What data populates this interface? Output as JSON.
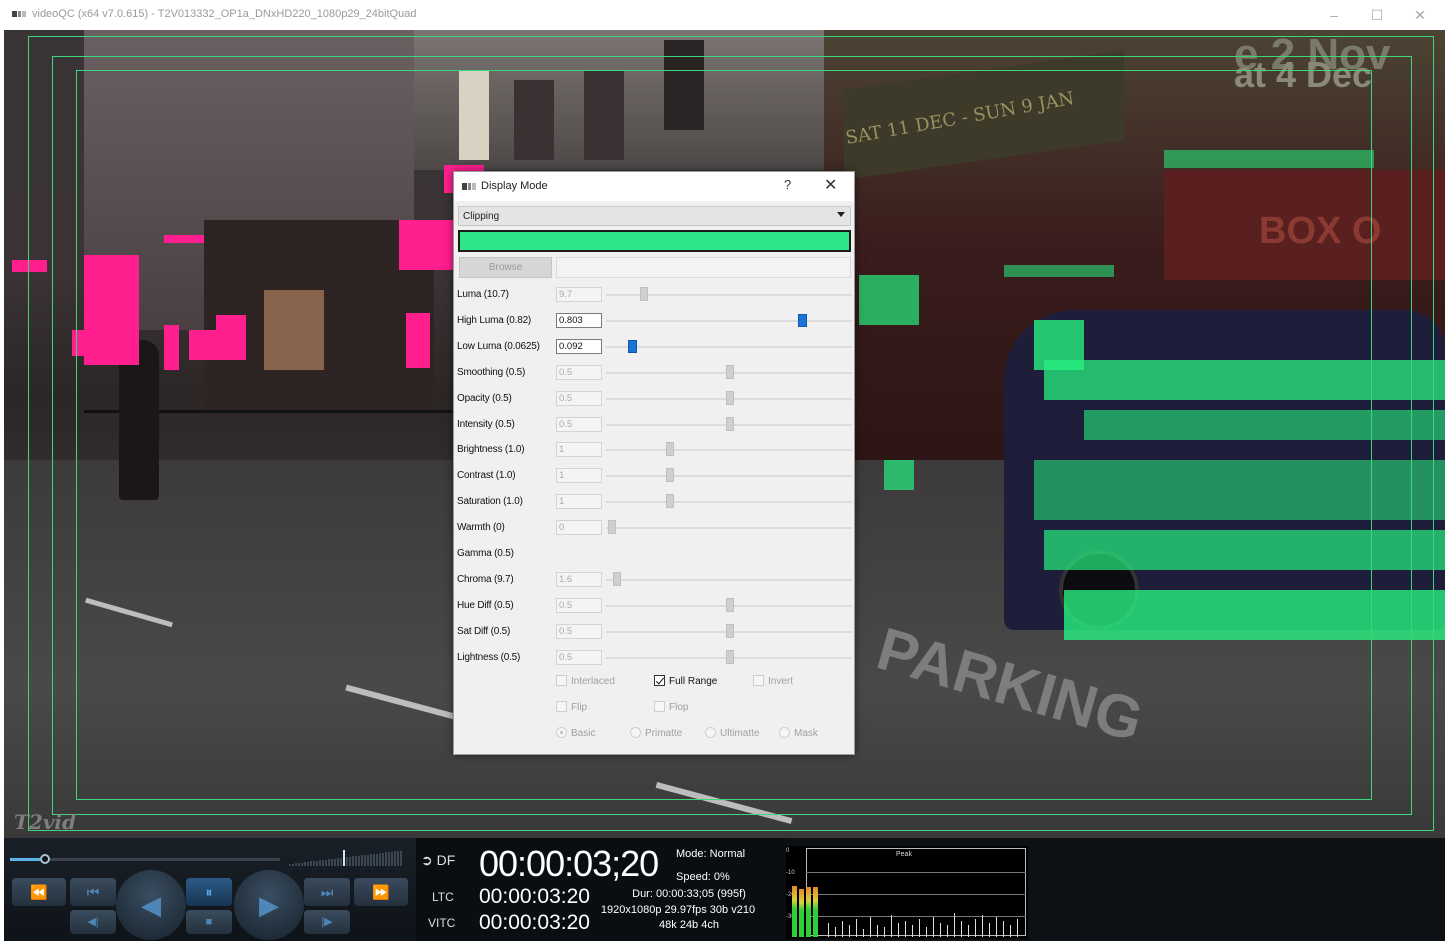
{
  "window": {
    "title": "videoQC (x64 v7.0.615) - T2V013332_OP1a_DNxHD220_1080p29_24bitQuad",
    "controls": {
      "minimize": "–",
      "maximize": "☐",
      "close": "✕"
    }
  },
  "video": {
    "signs": {
      "upper": "e 2 Nov",
      "lower": "at 4 Dec",
      "dates": "SAT 11 DEC - SUN 9 JAN",
      "box": "BOX O"
    },
    "road_text": "PARKING",
    "logo": "T2vid"
  },
  "dialog": {
    "title": "Display Mode",
    "help": "?",
    "close": "✕",
    "mode_selected": "Clipping",
    "clip_color": "#2ee68a",
    "browse_label": "Browse",
    "rows": [
      {
        "label": "Luma (10.7)",
        "value": "9.7",
        "active": false,
        "pos": 0.14
      },
      {
        "label": "High Luma (0.82)",
        "value": "0.803",
        "active": true,
        "pos": 0.8
      },
      {
        "label": "Low Luma (0.0625)",
        "value": "0.092",
        "active": true,
        "pos": 0.09
      },
      {
        "label": "Smoothing (0.5)",
        "value": "0.5",
        "active": false,
        "pos": 0.5
      },
      {
        "label": "Opacity (0.5)",
        "value": "0.5",
        "active": false,
        "pos": 0.5
      },
      {
        "label": "Intensity (0.5)",
        "value": "0.5",
        "active": false,
        "pos": 0.5
      },
      {
        "label": "Brightness (1.0)",
        "value": "1",
        "active": false,
        "pos": 0.25
      },
      {
        "label": "Contrast (1.0)",
        "value": "1",
        "active": false,
        "pos": 0.25
      },
      {
        "label": "Saturation (1.0)",
        "value": "1",
        "active": false,
        "pos": 0.25
      },
      {
        "label": "Warmth (0)",
        "value": "0",
        "active": false,
        "pos": 0.01
      },
      {
        "label": "Gamma (0.5)",
        "value": null,
        "active": false,
        "pos": null
      },
      {
        "label": "Chroma (9.7)",
        "value": "1.6",
        "active": false,
        "pos": 0.03
      },
      {
        "label": "Hue Diff (0.5)",
        "value": "0.5",
        "active": false,
        "pos": 0.5
      },
      {
        "label": "Sat Diff (0.5)",
        "value": "0.5",
        "active": false,
        "pos": 0.5
      },
      {
        "label": "Lightness (0.5)",
        "value": "0.5",
        "active": false,
        "pos": 0.5
      }
    ],
    "checks": {
      "interlaced": "Interlaced",
      "full_range": "Full Range",
      "invert": "Invert",
      "flip": "Flip",
      "flop": "Flop"
    },
    "radios": {
      "basic": "Basic",
      "primatte": "Primatte",
      "ultimatte": "Ultimatte",
      "mask": "Mask"
    }
  },
  "transport": {
    "icons": {
      "rewind": "⏪",
      "prev": "⏮",
      "play_rev": "◀",
      "pause": "⏸",
      "play": "▶",
      "next": "⏭",
      "ffwd": "⏩",
      "step_back": "◀|",
      "stop": "■",
      "step_fwd": "|▶"
    }
  },
  "timecode": {
    "df": "DF",
    "main": "00:00:03;20",
    "ltc_label": "LTC",
    "ltc": "00:00:03:20",
    "vitc_label": "VITC",
    "vitc": "00:00:03:20",
    "mode": "Mode: Normal",
    "speed": "Speed: 0%",
    "dur": "Dur: 00:00:33;05 (995f)",
    "format": "1920x1080p 29.97fps 30b v210",
    "audio": "48k 24b 4ch"
  },
  "meter": {
    "title": "Peak",
    "scale": [
      "0",
      "-10",
      "-20",
      "-30"
    ],
    "levels": [
      0.82,
      0.78,
      0.8,
      0.81
    ]
  }
}
